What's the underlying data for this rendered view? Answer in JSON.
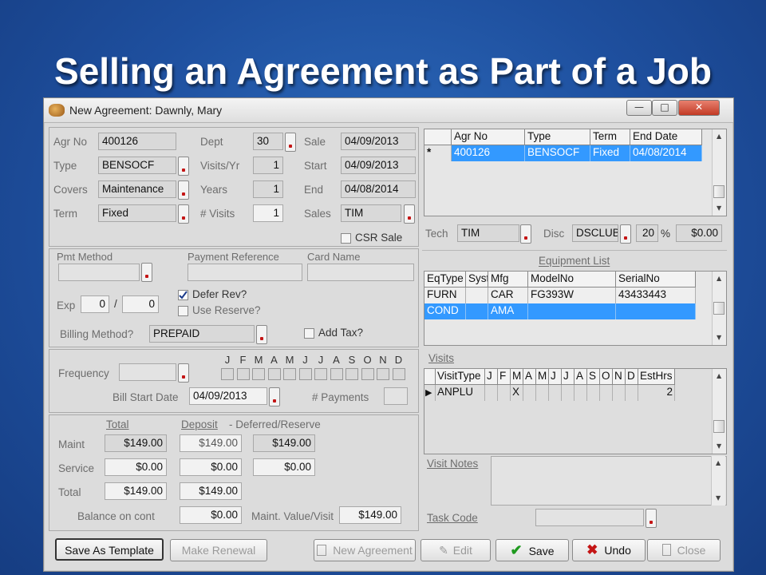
{
  "slide": {
    "title": "Selling an Agreement  as Part of a Job"
  },
  "window": {
    "title": "New Agreement: Dawnly, Mary",
    "min": "—",
    "max": "□",
    "close": "✕"
  },
  "agreement": {
    "agr_no_label": "Agr No",
    "agr_no": "400126",
    "type_label": "Type",
    "type": "BENSOCF",
    "covers_label": "Covers",
    "covers": "Maintenance",
    "term_label": "Term",
    "term": "Fixed",
    "dept_label": "Dept",
    "dept": "30",
    "visits_yr_label": "Visits/Yr",
    "visits_yr": "1",
    "years_label": "Years",
    "years": "1",
    "num_visits_label": "# Visits",
    "num_visits": "1",
    "sale_label": "Sale",
    "sale": "04/09/2013",
    "start_label": "Start",
    "start": "04/09/2013",
    "end_label": "End",
    "end": "04/08/2014",
    "sales_label": "Sales",
    "sales": "TIM",
    "csr_sale_label": "CSR Sale"
  },
  "payment": {
    "pmt_method_label": "Pmt Method",
    "payment_reference_label": "Payment Reference",
    "card_name_label": "Card Name",
    "exp_label": "Exp",
    "exp_month": "0",
    "exp_sep": "/",
    "exp_year": "0",
    "defer_rev_label": "Defer Rev?",
    "use_reserve_label": "Use Reserve?",
    "billing_method_label": "Billing Method?",
    "billing_method": "PREPAID",
    "add_tax_label": "Add Tax?"
  },
  "schedule": {
    "months": [
      "J",
      "F",
      "M",
      "A",
      "M",
      "J",
      "J",
      "A",
      "S",
      "O",
      "N",
      "D"
    ],
    "frequency_label": "Frequency",
    "bill_start_date_label": "Bill Start Date",
    "bill_start_date": "04/09/2013",
    "payments_label": "# Payments"
  },
  "totals": {
    "total_header": "Total",
    "deposit_header": "Deposit",
    "deferred_header": "- Deferred/Reserve",
    "maint_label": "Maint",
    "maint_total": "$149.00",
    "maint_deposit": "$149.00",
    "maint_deferred": "$149.00",
    "service_label": "Service",
    "service_total": "$0.00",
    "service_deposit": "$0.00",
    "service_deferred": "$0.00",
    "total_label": "Total",
    "total_total": "$149.00",
    "total_deposit": "$149.00",
    "balance_label": "Balance on cont",
    "balance": "$0.00",
    "maint_value_label": "Maint. Value/Visit",
    "maint_value": "$149.00"
  },
  "agreements_grid": {
    "columns": [
      "Agr No",
      "Type",
      "Term",
      "End Date"
    ],
    "row_marker": "*",
    "rows": [
      [
        "400126",
        "BENSOCF",
        "Fixed",
        "04/08/2014"
      ]
    ]
  },
  "tech": {
    "tech_label": "Tech",
    "tech": "TIM",
    "disc_label": "Disc",
    "disc": "DSCLUB",
    "pct": "20",
    "pct_sign": "%",
    "amount": "$0.00"
  },
  "equipment": {
    "title": "Equipment List",
    "columns": [
      "EqType",
      "Syst",
      "Mfg",
      "ModelNo",
      "SerialNo"
    ],
    "rows": [
      [
        "FURN",
        "",
        "CAR",
        "FG393W",
        "43433443"
      ],
      [
        "COND",
        "",
        "AMA",
        "",
        ""
      ]
    ]
  },
  "visits": {
    "title": "Visits",
    "columns": [
      "VisitType",
      "J",
      "F",
      "M",
      "A",
      "M",
      "J",
      "J",
      "A",
      "S",
      "O",
      "N",
      "D",
      "EstHrs"
    ],
    "row_marker": "▶",
    "rows": [
      [
        "ANPLU",
        "",
        "",
        "X",
        "",
        "",
        "",
        "",
        "",
        "",
        "",
        "",
        "",
        "2"
      ]
    ]
  },
  "notes": {
    "visit_notes_label": "Visit Notes",
    "task_code_label": "Task Code"
  },
  "buttons": {
    "save_as_template": "Save As Template",
    "make_renewal": "Make Renewal",
    "new_agreement": "New Agreement",
    "edit": "Edit",
    "save": "Save",
    "undo": "Undo",
    "close": "Close"
  },
  "colors": {
    "selection": "#3399ff",
    "accent_red": "#c41515",
    "check_green": "#1f9a1f"
  }
}
